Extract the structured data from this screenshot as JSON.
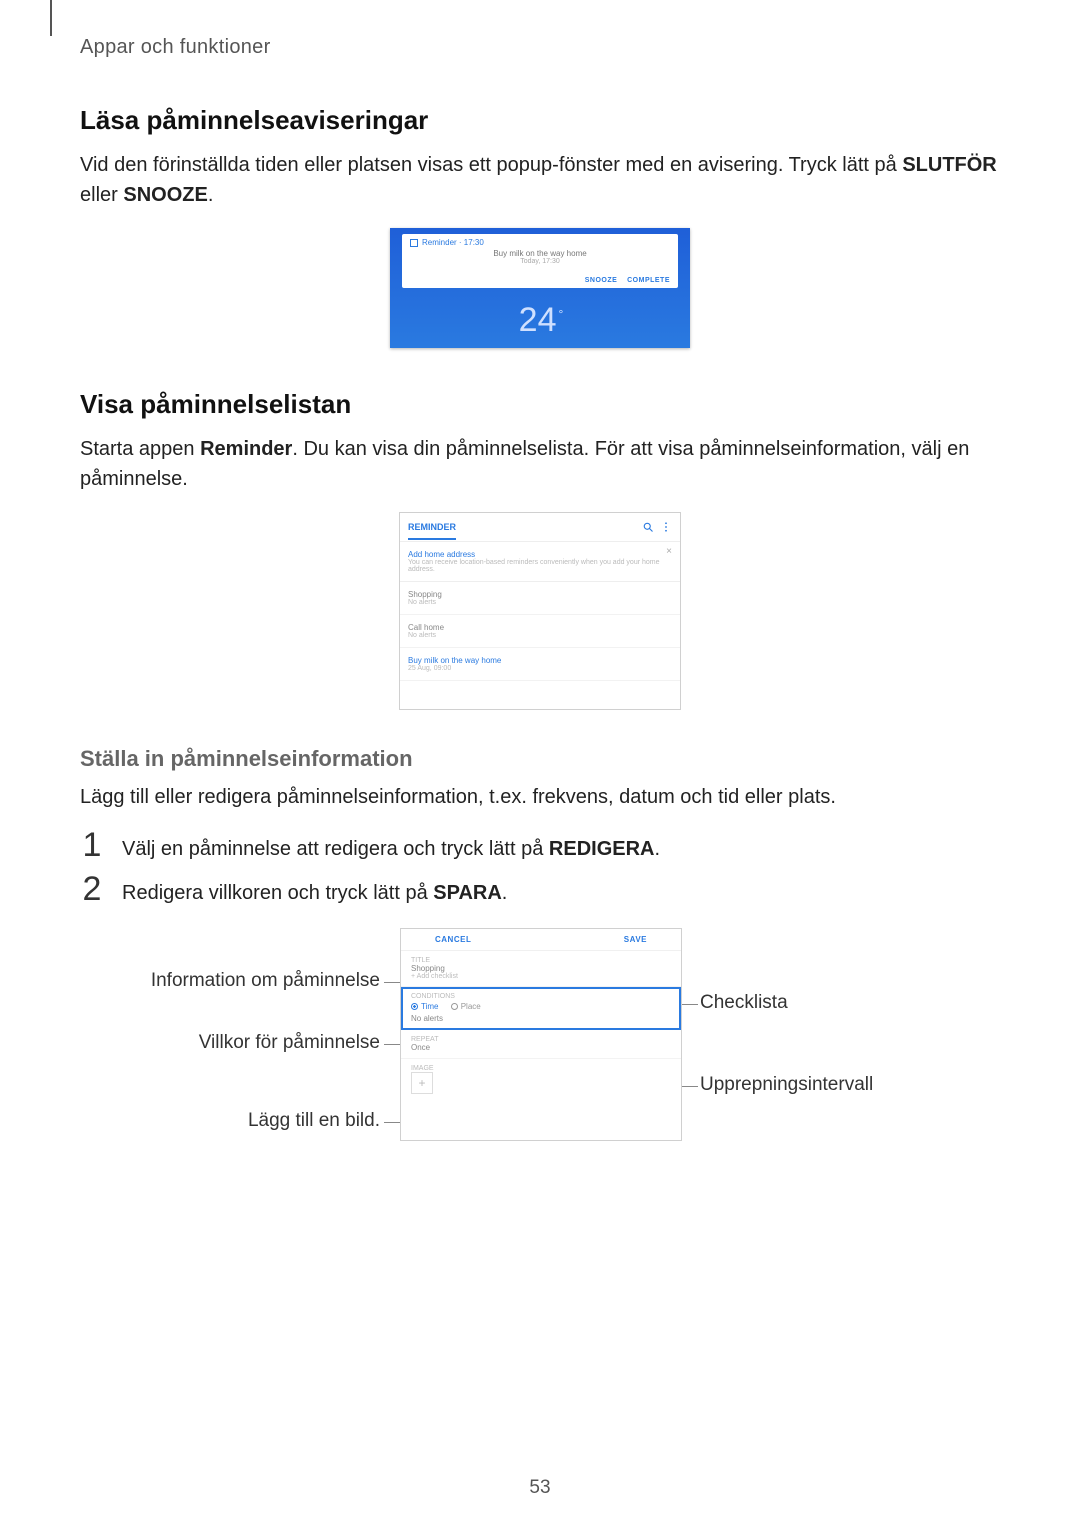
{
  "header": "Appar och funktioner",
  "section1": {
    "title": "Läsa påminnelseaviseringar",
    "body_pre": "Vid den förinställda tiden eller platsen visas ett popup-fönster med en avisering. Tryck lätt på ",
    "body_bold1": "SLUTFÖR",
    "body_mid": " eller ",
    "body_bold2": "SNOOZE",
    "body_post": "."
  },
  "fig1": {
    "app_label": "Reminder · 17:30",
    "line1": "Buy milk on the way home",
    "line2": "Today, 17:30",
    "action_snooze": "SNOOZE",
    "action_complete": "COMPLETE",
    "clock": "24",
    "clock_deg": "°"
  },
  "section2": {
    "title": "Visa påminnelselistan",
    "body_pre": "Starta appen ",
    "body_bold": "Reminder",
    "body_post": ". Du kan visa din påminnelselista. För att visa påminnelseinformation, välj en påminnelse."
  },
  "fig2": {
    "tab": "REMINDER",
    "promo_title": "Add home address",
    "promo_sub": "You can receive location-based reminders conveniently when you add your home address.",
    "items": [
      {
        "t": "Shopping",
        "s": "No alerts"
      },
      {
        "t": "Call home",
        "s": "No alerts"
      },
      {
        "t": "Buy milk on the way home",
        "s": "25 Aug, 09:00"
      }
    ]
  },
  "section3": {
    "title": "Ställa in påminnelseinformation",
    "body": "Lägg till eller redigera påminnelseinformation, t.ex. frekvens, datum och tid eller plats.",
    "step1_num": "1",
    "step1_pre": "Välj en påminnelse att redigera och tryck lätt på ",
    "step1_bold": "REDIGERA",
    "step1_post": ".",
    "step2_num": "2",
    "step2_pre": "Redigera villkoren och tryck lätt på ",
    "step2_bold": "SPARA",
    "step2_post": "."
  },
  "fig3": {
    "bar_cancel": "CANCEL",
    "bar_save": "SAVE",
    "title_lbl": "TITLE",
    "title_val": "Shopping",
    "title_hint": "+ Add checklist",
    "cond_lbl": "CONDITIONS",
    "cond_time": "Time",
    "cond_place": "Place",
    "cond_noalerts": "No alerts",
    "repeat_lbl": "REPEAT",
    "repeat_val": "Once",
    "image_lbl": "IMAGE",
    "image_plus": "+"
  },
  "callouts": {
    "info": "Information om påminnelse",
    "conditions": "Villkor för påminnelse",
    "add_image": "Lägg till en bild.",
    "checklist": "Checklista",
    "repeat": "Upprepningsintervall"
  },
  "page_number": "53"
}
